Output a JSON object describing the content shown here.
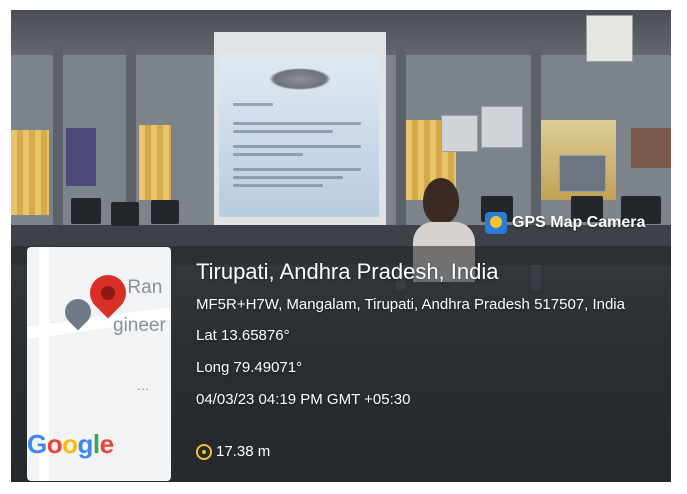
{
  "badge": {
    "label": "GPS Map Camera"
  },
  "map": {
    "labels": [
      "ee Ran",
      "gineer"
    ],
    "brand": [
      "G",
      "o",
      "o",
      "g",
      "l",
      "e"
    ],
    "more": "..."
  },
  "location": {
    "city": "Tirupati, Andhra Pradesh, India",
    "address": "MF5R+H7W, Mangalam, Tirupati, Andhra Pradesh 517507, India",
    "lat": "Lat 13.65876°",
    "long": "Long 79.49071°",
    "datetime": "04/03/23 04:19 PM GMT +05:30",
    "altitude": "17.38 m"
  }
}
